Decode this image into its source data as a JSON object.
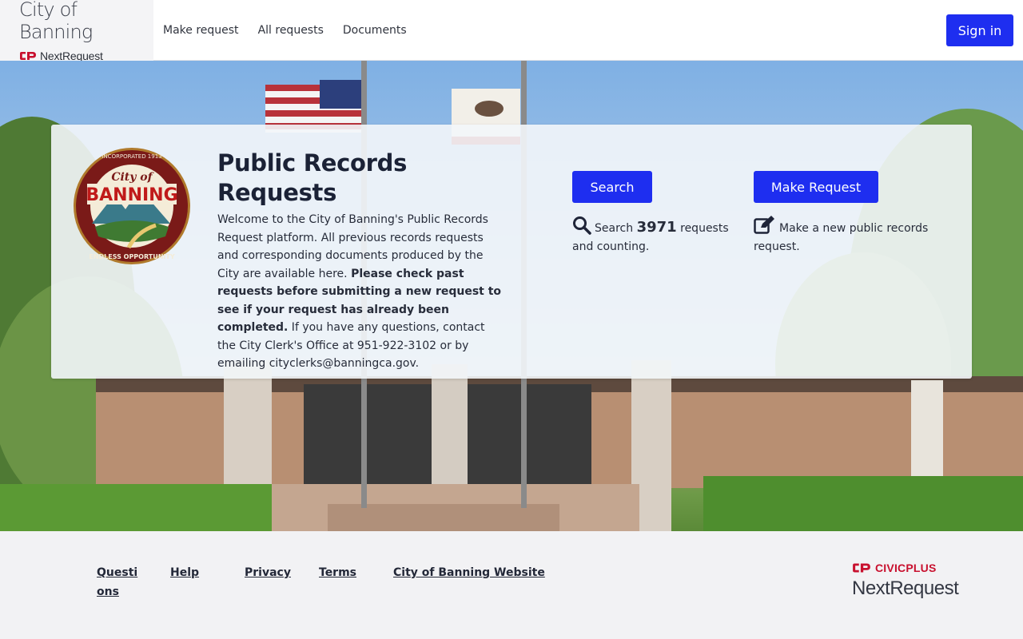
{
  "header": {
    "brand_title": "City of Banning",
    "brand_sub": "NextRequest",
    "nav": [
      "Make request",
      "All requests",
      "Documents"
    ],
    "signin": "Sign in"
  },
  "hero": {
    "title": "Public Records Requests",
    "intro_1": "Welcome to the City of Banning's Public Records Request platform. All previous records requests and corresponding documents produced by the City are available here. ",
    "intro_bold": "Please check past requests before submitting a new request to see if your request has already been completed.",
    "intro_2": " If you have any questions, contact the City Clerk's Office at 951-922-3102 or by emailing cityclerks@banningca.gov.",
    "seal_text": "CITY OF BANNING — INCORPORATED 1913 — ENDLESS OPPORTUNITY",
    "search": {
      "button": "Search",
      "prefix": "Search ",
      "count": "3971",
      "suffix": " requests and counting."
    },
    "make": {
      "button": "Make Request",
      "desc": "Make a new public records request."
    }
  },
  "footer": {
    "links": [
      "Questions",
      "Help",
      "Privacy",
      "Terms",
      "City of Banning Website"
    ],
    "civicplus": "CIVICPLUS",
    "nextrequest": "NextRequest"
  },
  "colors": {
    "accent": "#1e2ef0",
    "brand_red": "#c8102e",
    "text": "#1e2438"
  },
  "icons": [
    "cp-logo-icon",
    "search-icon",
    "edit-icon",
    "city-seal"
  ]
}
